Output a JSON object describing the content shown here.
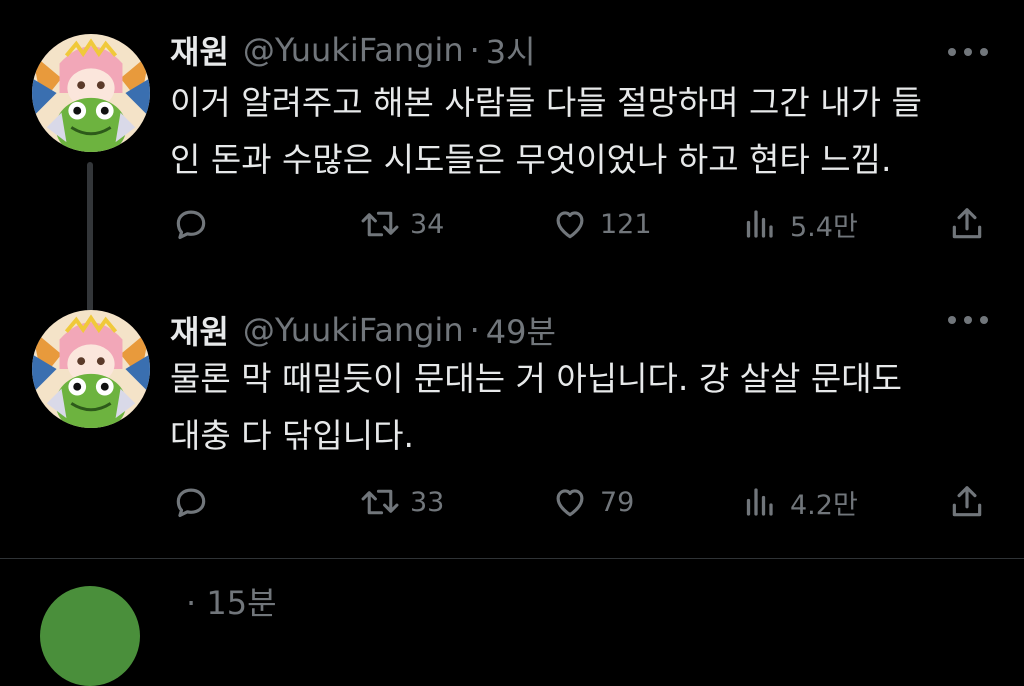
{
  "tweets": [
    {
      "name": "재원",
      "handle": "@YuukiFangin",
      "separator": "·",
      "time": "3시",
      "lines": [
        "이거 알려주고 해본 사람들 다들 절망하며 그간 내가 들",
        "인 돈과 수많은 시도들은 무엇이었나 하고 현타 느낌."
      ],
      "retweets": "34",
      "likes": "121",
      "views": "5.4만"
    },
    {
      "name": "재원",
      "handle": "@YuukiFangin",
      "separator": "·",
      "time": "49분",
      "lines": [
        "물론 막 때밀듯이 문대는 거 아닙니다. 걍 살살 문대도",
        "대충 다 닦입니다."
      ],
      "retweets": "33",
      "likes": "79",
      "views": "4.2만"
    }
  ],
  "peek": {
    "name": "",
    "text": "· 15분"
  },
  "colors": {
    "background": "#000000",
    "text": "#e7e9ea",
    "muted": "#71767b",
    "thread_line": "#333639"
  }
}
